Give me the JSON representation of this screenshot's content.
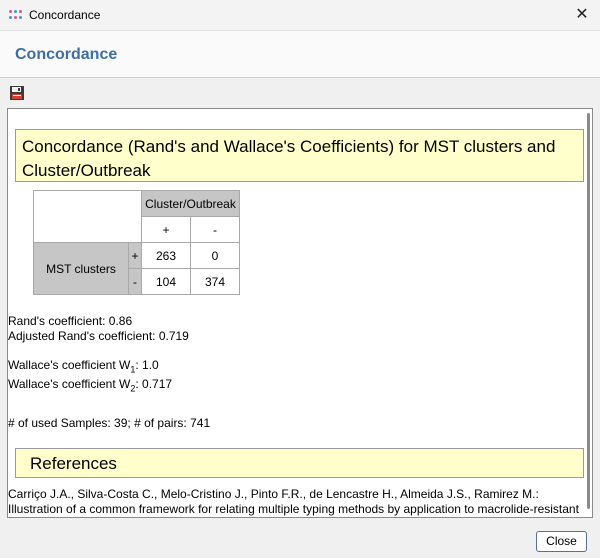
{
  "window": {
    "title": "Concordance",
    "close_glyph": "✕"
  },
  "header": {
    "title": "Concordance"
  },
  "toolbar": {
    "save_icon": "floppy-disk-icon"
  },
  "report": {
    "title": "Concordance (Rand's and Wallace's Coefficients) for MST clusters and Cluster/Outbreak",
    "table": {
      "col_group": "Cluster/Outbreak",
      "col_signs": [
        "+",
        "-"
      ],
      "row_group": "MST clusters",
      "rows": [
        {
          "sign": "+",
          "values": [
            "263",
            "0"
          ]
        },
        {
          "sign": "-",
          "values": [
            "104",
            "374"
          ]
        }
      ]
    },
    "rand": "Rand's coefficient: 0.86",
    "adjusted_rand": "Adjusted Rand's coefficient: 0.719",
    "wallace1": {
      "prefix": "Wallace's coefficient W",
      "sub": "1",
      "suffix": ": 1.0"
    },
    "wallace2": {
      "prefix": "Wallace's coefficient W",
      "sub": "2",
      "suffix": ": 0.717"
    },
    "samples": "# of used Samples: 39; # of pairs: 741",
    "references_heading": "References",
    "reference_line1": "Carriço J.A., Silva-Costa C., Melo-Cristino J., Pinto F.R., de Lencastre H., Almeida J.S., Ramirez M.:",
    "reference_line2": "Illustration of a common framework for relating multiple typing methods by application to macrolide-resistant"
  },
  "footer": {
    "close_label": "Close"
  },
  "colors": {
    "accent": "#3c6fa8",
    "highlight_box": "#ffffcc",
    "table_header": "#c6c6c6"
  }
}
